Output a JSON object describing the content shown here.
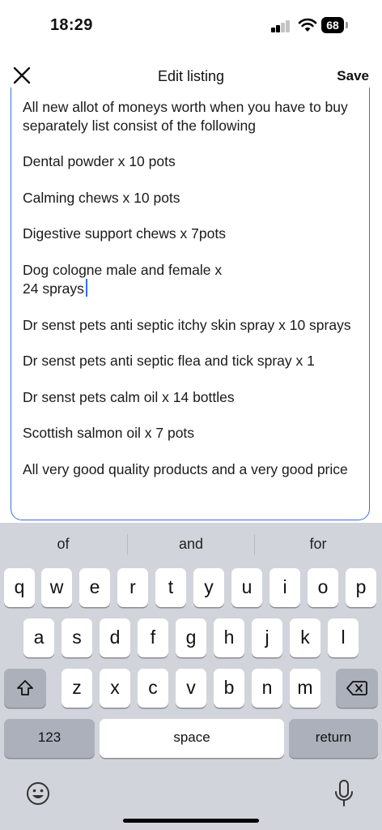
{
  "status": {
    "time": "18:29",
    "battery": "68"
  },
  "nav": {
    "title": "Edit listing",
    "save": "Save"
  },
  "listing": {
    "paragraphs": [
      "All new allot of moneys worth when you have to buy separately list consist of the following",
      "Dental powder x 10 pots",
      "Calming chews x 10 pots",
      "Digestive support chews x 7pots",
      "Dog cologne male and female x\n24 sprays",
      "Dr senst pets anti septic itchy skin spray x 10 sprays",
      "Dr senst pets anti septic flea and tick spray x 1",
      "Dr senst pets calm oil x 14 bottles",
      "Scottish salmon oil x 7 pots",
      "All very good quality products and a very good price"
    ]
  },
  "keyboard": {
    "suggestions": [
      "of",
      "and",
      "for"
    ],
    "row1": [
      "q",
      "w",
      "e",
      "r",
      "t",
      "y",
      "u",
      "i",
      "o",
      "p"
    ],
    "row2": [
      "a",
      "s",
      "d",
      "f",
      "g",
      "h",
      "j",
      "k",
      "l"
    ],
    "row3": [
      "z",
      "x",
      "c",
      "v",
      "b",
      "n",
      "m"
    ],
    "numbers_label": "123",
    "space_label": "space",
    "return_label": "return"
  },
  "icons": {
    "close": "close-icon",
    "shift": "shift-icon",
    "backspace": "backspace-icon",
    "emoji": "emoji-icon",
    "mic": "microphone-icon",
    "signal": "cellular-signal-icon",
    "wifi": "wifi-icon"
  }
}
